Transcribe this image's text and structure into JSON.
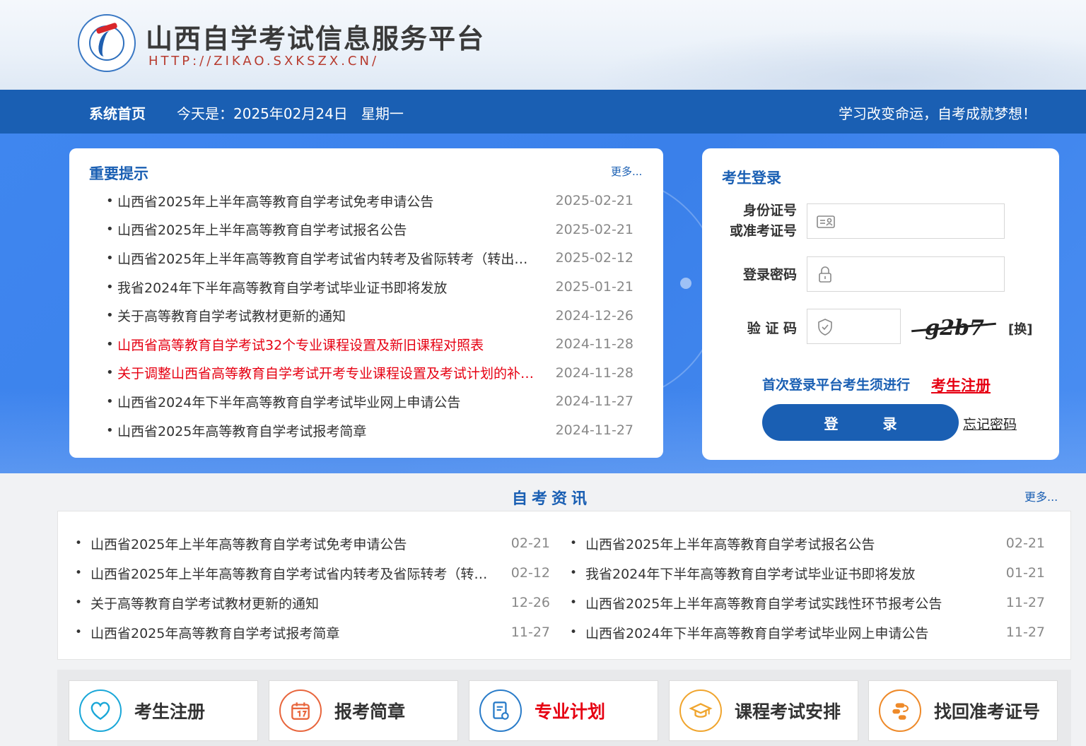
{
  "header": {
    "site_title": "山西自学考试信息服务平台",
    "site_url": "HTTP://ZIKAO.SXKSZX.CN/"
  },
  "navbar": {
    "home": "系统首页",
    "date": "今天是：2025年02月24日   星期一",
    "slogan": "学习改变命运，自考成就梦想！"
  },
  "notice": {
    "title": "重要提示",
    "more": "更多...",
    "items": [
      {
        "title": "山西省2025年上半年高等教育自学考试免考申请公告",
        "date": "2025-02-21",
        "highlight": false
      },
      {
        "title": "山西省2025年上半年高等教育自学考试报名公告",
        "date": "2025-02-21",
        "highlight": false
      },
      {
        "title": "山西省2025年上半年高等教育自学考试省内转考及省际转考（转出…",
        "date": "2025-02-12",
        "highlight": false
      },
      {
        "title": "我省2024年下半年高等教育自学考试毕业证书即将发放",
        "date": "2025-01-21",
        "highlight": false
      },
      {
        "title": "关于高等教育自学考试教材更新的通知",
        "date": "2024-12-26",
        "highlight": false
      },
      {
        "title": "山西省高等教育自学考试32个专业课程设置及新旧课程对照表",
        "date": "2024-11-28",
        "highlight": true
      },
      {
        "title": "关于调整山西省高等教育自学考试开考专业课程设置及考试计划的补…",
        "date": "2024-11-28",
        "highlight": true
      },
      {
        "title": "山西省2024年下半年高等教育自学考试毕业网上申请公告",
        "date": "2024-11-27",
        "highlight": false
      },
      {
        "title": "山西省2025年高等教育自学考试报考简章",
        "date": "2024-11-27",
        "highlight": false
      }
    ]
  },
  "login": {
    "title": "考生登录",
    "id_label_1": "身份证号",
    "id_label_2": "或准考证号",
    "password_label": "登录密码",
    "captcha_label": "验 证 码",
    "captcha_text": "g2b7",
    "captcha_refresh": "[换]",
    "register_hint": "首次登录平台考生须进行",
    "register_link": "考生注册",
    "submit": "登 录",
    "forgot": "忘记密码"
  },
  "news": {
    "title": "自考资讯",
    "more": "更多...",
    "left": [
      {
        "title": "山西省2025年上半年高等教育自学考试免考申请公告",
        "date": "02-21"
      },
      {
        "title": "山西省2025年上半年高等教育自学考试省内转考及省际转考（转…",
        "date": "02-12"
      },
      {
        "title": "关于高等教育自学考试教材更新的通知",
        "date": "12-26"
      },
      {
        "title": "山西省2025年高等教育自学考试报考简章",
        "date": "11-27"
      }
    ],
    "right": [
      {
        "title": "山西省2025年上半年高等教育自学考试报名公告",
        "date": "02-21"
      },
      {
        "title": "我省2024年下半年高等教育自学考试毕业证书即将发放",
        "date": "01-21"
      },
      {
        "title": "山西省2025年上半年高等教育自学考试实践性环节报考公告",
        "date": "11-27"
      },
      {
        "title": "山西省2024年下半年高等教育自学考试毕业网上申请公告",
        "date": "11-27"
      }
    ]
  },
  "quick_links": [
    {
      "label": "考生注册",
      "icon": "heart-icon",
      "color": "#1aa7d8",
      "label_color": "#333333"
    },
    {
      "label": "报考简章",
      "icon": "calendar-icon",
      "color": "#e8663d",
      "label_color": "#333333"
    },
    {
      "label": "专业计划",
      "icon": "document-icon",
      "color": "#2a7cc9",
      "label_color": "#e60012"
    },
    {
      "label": "课程考试安排",
      "icon": "graduation-cap-icon",
      "color": "#f0a52e",
      "label_color": "#333333"
    },
    {
      "label": "找回准考证号",
      "icon": "retrieve-icon",
      "color": "#ee8a2a",
      "label_color": "#333333"
    }
  ],
  "colors": {
    "brand_blue": "#1a5fb3",
    "hero_blue": "#3f86ef",
    "highlight_red": "#e60012"
  }
}
